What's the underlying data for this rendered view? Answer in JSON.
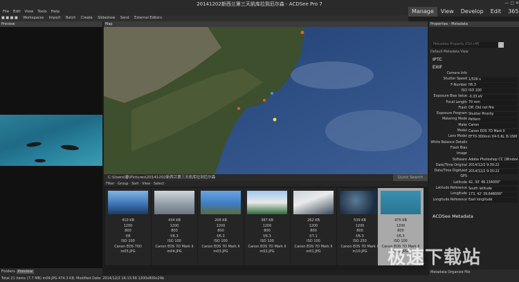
{
  "window": {
    "title": "20141202新西兰第三天凯库拉到厄尔森 - ACDSee Pro 7"
  },
  "menu": [
    "File",
    "Edit",
    "View",
    "Tools",
    "Help"
  ],
  "modes": [
    "Manage",
    "View",
    "Develop",
    "Edit",
    "365"
  ],
  "toolbar": [
    "Workspaces",
    "Import",
    "Batch",
    "Create",
    "Slideshow",
    "Send",
    "External Editors"
  ],
  "panels": {
    "preview": "Preview",
    "map": "Map",
    "properties": "Properties - Metadata"
  },
  "path": "C:\\Users\\春\\Pictures\\20141202新西兰第三天凯库拉到厄尔森",
  "quick_search": "Quick Search",
  "filter_bar": "Filter · Group · Sort · View · Select ·",
  "thumbnails": [
    {
      "size": "410 KB",
      "w": "1200",
      "h": "800",
      "f": "f/8",
      "iso": "ISO 100",
      "camera": "Canon EOS 70D",
      "name": "m05.JPG"
    },
    {
      "size": "434 KB",
      "w": "1200",
      "h": "800",
      "f": "f/6.3",
      "iso": "ISO 100",
      "camera": "Canon EOS 7D Mark II",
      "name": "m04.JPG"
    },
    {
      "size": "208 KB",
      "w": "1200",
      "h": "800",
      "f": "f/6.3",
      "iso": "ISO 100",
      "camera": "Canon EOS 7D Mark II",
      "name": "m03.JPG"
    },
    {
      "size": "387 KB",
      "w": "1200",
      "h": "800",
      "f": "f/6.3",
      "iso": "ISO 100",
      "camera": "Canon EOS 7D Mark II",
      "name": "m02.JPG"
    },
    {
      "size": "262 KB",
      "w": "1200",
      "h": "800",
      "f": "f/7.1",
      "iso": "ISO 100",
      "camera": "Canon EOS 7D Mark II",
      "name": "m01.JPG"
    },
    {
      "size": "539 KB",
      "w": "1200",
      "h": "800",
      "f": "f/6.3",
      "iso": "ISO 250",
      "camera": "Canon EOS 7D Mark II",
      "name": "m10.JPG"
    },
    {
      "size": "475 KB",
      "w": "1200",
      "h": "800",
      "f": "f/6.3",
      "iso": "ISO 100",
      "camera": "Canon EOS 7D Mark II",
      "name": "m09.JPG"
    }
  ],
  "properties": {
    "search_placeholder": "Metadata Property (Ctrl+M)",
    "view": "Default Metadata View",
    "sections": [
      "IPTC",
      "EXIF"
    ],
    "rows": [
      {
        "k": "Camera Info",
        "v": ""
      },
      {
        "k": "Shutter Speed",
        "v": "1/500 s"
      },
      {
        "k": "F-Number",
        "v": "f/6.3"
      },
      {
        "k": "ISO",
        "v": "ISO 100"
      },
      {
        "k": "Exposure Bias Value",
        "v": "-0.33 eV"
      },
      {
        "k": "Focal Length",
        "v": "70 mm"
      },
      {
        "k": "Flash",
        "v": "Off, Did not fire"
      },
      {
        "k": "Exposure Program",
        "v": "Shutter Priority"
      },
      {
        "k": "Metering Mode",
        "v": "Pattern"
      },
      {
        "k": "Make",
        "v": "Canon"
      },
      {
        "k": "Model",
        "v": "Canon EOS 7D Mark II"
      },
      {
        "k": "Lens Model",
        "v": "EF70-300mm f/4-5.6L IS USM"
      },
      {
        "k": "White Balance Details",
        "v": ""
      },
      {
        "k": "Flash Bias",
        "v": ""
      },
      {
        "k": "Image",
        "v": ""
      },
      {
        "k": "Software",
        "v": "Adobe Photoshop CC (Windows)"
      },
      {
        "k": "Date/Time Original",
        "v": "2014/12/2 9:30:22"
      },
      {
        "k": "Date/Time Digitized",
        "v": "2014/12/2 9:30:22"
      },
      {
        "k": "GPS",
        "v": ""
      },
      {
        "k": "Latitude",
        "v": "42, 30' 46.134000\""
      },
      {
        "k": "Latitude Reference",
        "v": "South latitude"
      },
      {
        "k": "Longitude",
        "v": "173, 42' 39.648000\""
      },
      {
        "k": "Longitude Reference",
        "v": "East longitude"
      }
    ],
    "acdsee_section": "ACDSee Metadata"
  },
  "foot_tabs": [
    "Folders",
    "Preview"
  ],
  "meta_tabs": "Metadata  Organize  File",
  "status": "Total 21 items  (7.7 MB)  m09.JPG  474.3 KB, Modified Date: 2014/12/2 16:13:56  1200x800x24b",
  "watermark": "极速下载站"
}
